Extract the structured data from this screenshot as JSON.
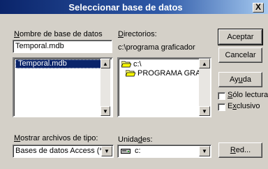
{
  "dialog": {
    "title": "Seleccionar base de datos",
    "close_glyph": "X"
  },
  "dbname": {
    "label_u": "N",
    "label_rest": "ombre de base de datos",
    "value": "Temporal.mdb",
    "list": [
      "Temporal.mdb"
    ]
  },
  "dirs": {
    "label_u": "D",
    "label_rest": "irectorios:",
    "path": "c:\\programa graficador",
    "items": [
      {
        "label": "c:\\",
        "icon": "open-folder-icon"
      },
      {
        "label": "PROGRAMA GRA",
        "icon": "open-folder-icon"
      }
    ]
  },
  "filetype": {
    "label_u": "M",
    "label_rest": "ostrar archivos de tipo:",
    "value": "Bases de datos Access (*."
  },
  "drives": {
    "label_pre": "Unida",
    "label_u": "d",
    "label_rest": "es:",
    "value": "c:",
    "icon": "drive-icon"
  },
  "buttons": {
    "accept": "Aceptar",
    "cancel": "Cancelar",
    "help_pre": "Ay",
    "help_u": "u",
    "help_rest": "da",
    "network_u": "R",
    "network_rest": "ed..."
  },
  "options": {
    "readonly_u": "S",
    "readonly_rest": "ólo lectura",
    "exclusive_pre": "E",
    "exclusive_u": "x",
    "exclusive_rest": "clusivo"
  },
  "scroll": {
    "up_glyph": "▲",
    "down_glyph": "▼"
  }
}
